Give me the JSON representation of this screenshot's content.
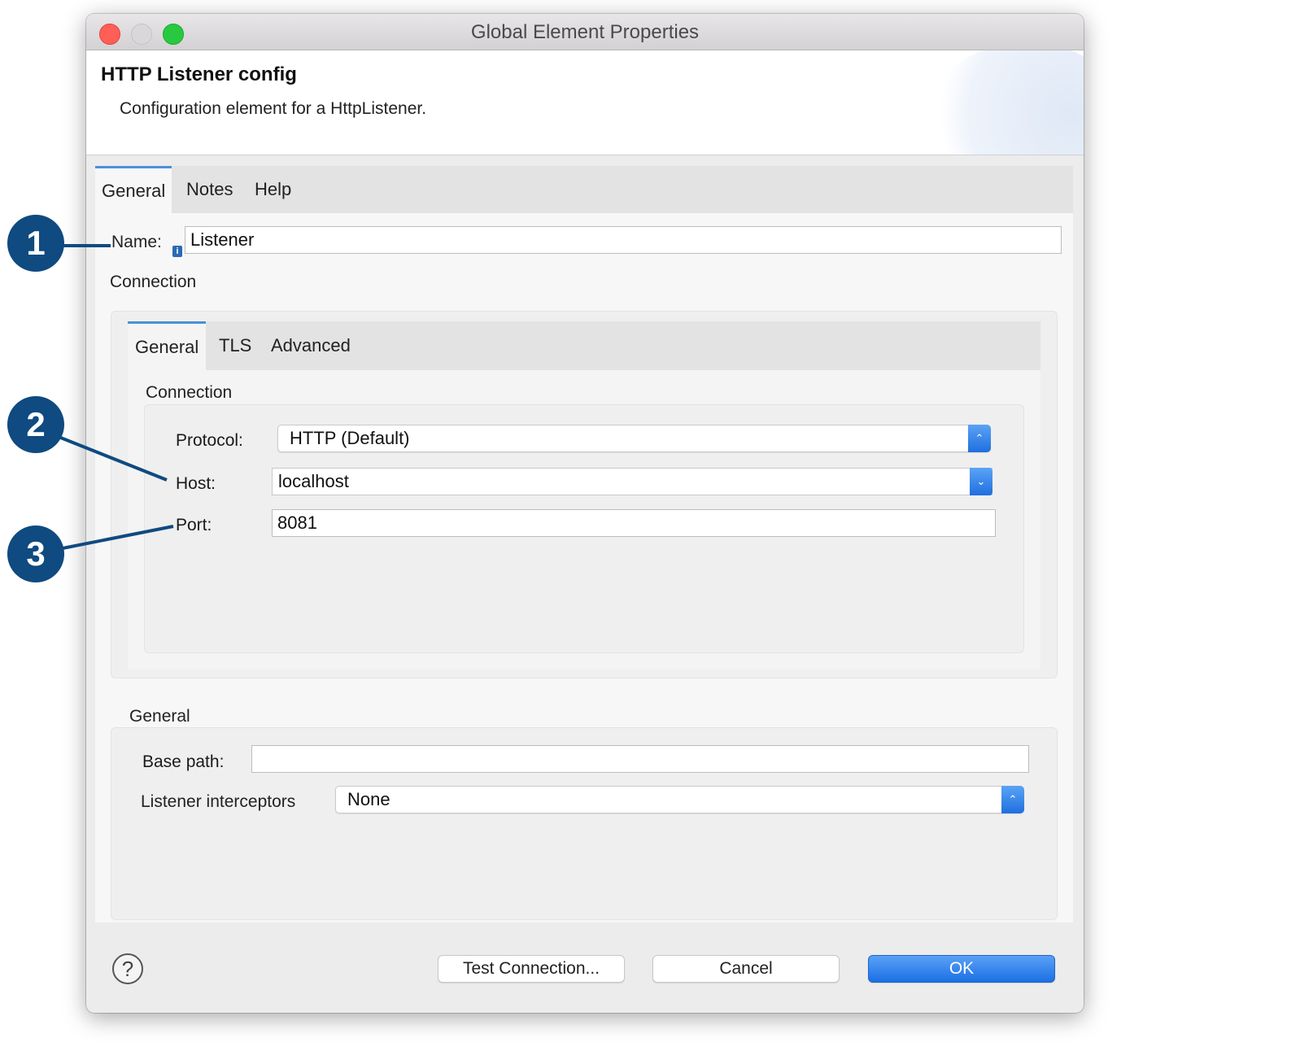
{
  "window": {
    "title": "Global Element Properties"
  },
  "header": {
    "title": "HTTP Listener config",
    "description": "Configuration element for a HttpListener."
  },
  "tabs": [
    "General",
    "Notes",
    "Help"
  ],
  "name_field": {
    "label": "Name:",
    "value": "Listener",
    "info_icon": "info-icon"
  },
  "connection": {
    "section_label": "Connection",
    "inner_tabs": [
      "General",
      "TLS",
      "Advanced"
    ],
    "group_label": "Connection",
    "protocol": {
      "label": "Protocol:",
      "value": "HTTP (Default)"
    },
    "host": {
      "label": "Host:",
      "value": "localhost"
    },
    "port": {
      "label": "Port:",
      "value": "8081"
    }
  },
  "general": {
    "section_label": "General",
    "base_path": {
      "label": "Base path:",
      "value": ""
    },
    "listener_interceptors": {
      "label": "Listener interceptors",
      "value": "None"
    }
  },
  "footer": {
    "help": "?",
    "test_connection": "Test Connection...",
    "cancel": "Cancel",
    "ok": "OK"
  },
  "callouts": [
    "1",
    "2",
    "3"
  ],
  "colors": {
    "accent": "#1c6fe4",
    "callout": "#0f4a80",
    "tab_indicator": "#4a90d9"
  }
}
